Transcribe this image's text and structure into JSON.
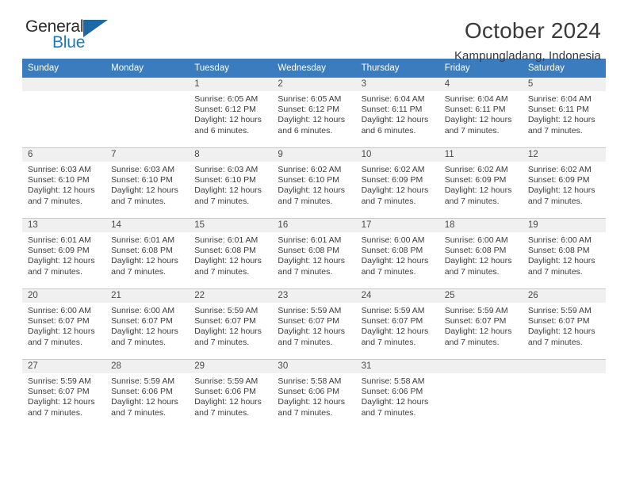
{
  "brand": {
    "name_part1": "General",
    "name_part2": "Blue",
    "triangle_color": "#1c69a8",
    "blue_color": "#1f79c0"
  },
  "header": {
    "title": "October 2024",
    "subtitle": "Kampungladang, Indonesia",
    "header_bg": "#3a7cbe",
    "daynum_bg": "#f0f0f0"
  },
  "weekdays": [
    "Sunday",
    "Monday",
    "Tuesday",
    "Wednesday",
    "Thursday",
    "Friday",
    "Saturday"
  ],
  "labels": {
    "sunrise_prefix": "Sunrise: ",
    "sunset_prefix": "Sunset: ",
    "daylight_prefix": "Daylight: "
  },
  "weeks": [
    [
      {
        "day": "",
        "empty": true
      },
      {
        "day": "",
        "empty": true
      },
      {
        "day": "1",
        "sunrise": "Sunrise: 6:05 AM",
        "sunset": "Sunset: 6:12 PM",
        "daylight1": "Daylight: 12 hours",
        "daylight2": "and 6 minutes."
      },
      {
        "day": "2",
        "sunrise": "Sunrise: 6:05 AM",
        "sunset": "Sunset: 6:12 PM",
        "daylight1": "Daylight: 12 hours",
        "daylight2": "and 6 minutes."
      },
      {
        "day": "3",
        "sunrise": "Sunrise: 6:04 AM",
        "sunset": "Sunset: 6:11 PM",
        "daylight1": "Daylight: 12 hours",
        "daylight2": "and 6 minutes."
      },
      {
        "day": "4",
        "sunrise": "Sunrise: 6:04 AM",
        "sunset": "Sunset: 6:11 PM",
        "daylight1": "Daylight: 12 hours",
        "daylight2": "and 7 minutes."
      },
      {
        "day": "5",
        "sunrise": "Sunrise: 6:04 AM",
        "sunset": "Sunset: 6:11 PM",
        "daylight1": "Daylight: 12 hours",
        "daylight2": "and 7 minutes."
      }
    ],
    [
      {
        "day": "6",
        "sunrise": "Sunrise: 6:03 AM",
        "sunset": "Sunset: 6:10 PM",
        "daylight1": "Daylight: 12 hours",
        "daylight2": "and 7 minutes."
      },
      {
        "day": "7",
        "sunrise": "Sunrise: 6:03 AM",
        "sunset": "Sunset: 6:10 PM",
        "daylight1": "Daylight: 12 hours",
        "daylight2": "and 7 minutes."
      },
      {
        "day": "8",
        "sunrise": "Sunrise: 6:03 AM",
        "sunset": "Sunset: 6:10 PM",
        "daylight1": "Daylight: 12 hours",
        "daylight2": "and 7 minutes."
      },
      {
        "day": "9",
        "sunrise": "Sunrise: 6:02 AM",
        "sunset": "Sunset: 6:10 PM",
        "daylight1": "Daylight: 12 hours",
        "daylight2": "and 7 minutes."
      },
      {
        "day": "10",
        "sunrise": "Sunrise: 6:02 AM",
        "sunset": "Sunset: 6:09 PM",
        "daylight1": "Daylight: 12 hours",
        "daylight2": "and 7 minutes."
      },
      {
        "day": "11",
        "sunrise": "Sunrise: 6:02 AM",
        "sunset": "Sunset: 6:09 PM",
        "daylight1": "Daylight: 12 hours",
        "daylight2": "and 7 minutes."
      },
      {
        "day": "12",
        "sunrise": "Sunrise: 6:02 AM",
        "sunset": "Sunset: 6:09 PM",
        "daylight1": "Daylight: 12 hours",
        "daylight2": "and 7 minutes."
      }
    ],
    [
      {
        "day": "13",
        "sunrise": "Sunrise: 6:01 AM",
        "sunset": "Sunset: 6:09 PM",
        "daylight1": "Daylight: 12 hours",
        "daylight2": "and 7 minutes."
      },
      {
        "day": "14",
        "sunrise": "Sunrise: 6:01 AM",
        "sunset": "Sunset: 6:08 PM",
        "daylight1": "Daylight: 12 hours",
        "daylight2": "and 7 minutes."
      },
      {
        "day": "15",
        "sunrise": "Sunrise: 6:01 AM",
        "sunset": "Sunset: 6:08 PM",
        "daylight1": "Daylight: 12 hours",
        "daylight2": "and 7 minutes."
      },
      {
        "day": "16",
        "sunrise": "Sunrise: 6:01 AM",
        "sunset": "Sunset: 6:08 PM",
        "daylight1": "Daylight: 12 hours",
        "daylight2": "and 7 minutes."
      },
      {
        "day": "17",
        "sunrise": "Sunrise: 6:00 AM",
        "sunset": "Sunset: 6:08 PM",
        "daylight1": "Daylight: 12 hours",
        "daylight2": "and 7 minutes."
      },
      {
        "day": "18",
        "sunrise": "Sunrise: 6:00 AM",
        "sunset": "Sunset: 6:08 PM",
        "daylight1": "Daylight: 12 hours",
        "daylight2": "and 7 minutes."
      },
      {
        "day": "19",
        "sunrise": "Sunrise: 6:00 AM",
        "sunset": "Sunset: 6:08 PM",
        "daylight1": "Daylight: 12 hours",
        "daylight2": "and 7 minutes."
      }
    ],
    [
      {
        "day": "20",
        "sunrise": "Sunrise: 6:00 AM",
        "sunset": "Sunset: 6:07 PM",
        "daylight1": "Daylight: 12 hours",
        "daylight2": "and 7 minutes."
      },
      {
        "day": "21",
        "sunrise": "Sunrise: 6:00 AM",
        "sunset": "Sunset: 6:07 PM",
        "daylight1": "Daylight: 12 hours",
        "daylight2": "and 7 minutes."
      },
      {
        "day": "22",
        "sunrise": "Sunrise: 5:59 AM",
        "sunset": "Sunset: 6:07 PM",
        "daylight1": "Daylight: 12 hours",
        "daylight2": "and 7 minutes."
      },
      {
        "day": "23",
        "sunrise": "Sunrise: 5:59 AM",
        "sunset": "Sunset: 6:07 PM",
        "daylight1": "Daylight: 12 hours",
        "daylight2": "and 7 minutes."
      },
      {
        "day": "24",
        "sunrise": "Sunrise: 5:59 AM",
        "sunset": "Sunset: 6:07 PM",
        "daylight1": "Daylight: 12 hours",
        "daylight2": "and 7 minutes."
      },
      {
        "day": "25",
        "sunrise": "Sunrise: 5:59 AM",
        "sunset": "Sunset: 6:07 PM",
        "daylight1": "Daylight: 12 hours",
        "daylight2": "and 7 minutes."
      },
      {
        "day": "26",
        "sunrise": "Sunrise: 5:59 AM",
        "sunset": "Sunset: 6:07 PM",
        "daylight1": "Daylight: 12 hours",
        "daylight2": "and 7 minutes."
      }
    ],
    [
      {
        "day": "27",
        "sunrise": "Sunrise: 5:59 AM",
        "sunset": "Sunset: 6:07 PM",
        "daylight1": "Daylight: 12 hours",
        "daylight2": "and 7 minutes."
      },
      {
        "day": "28",
        "sunrise": "Sunrise: 5:59 AM",
        "sunset": "Sunset: 6:06 PM",
        "daylight1": "Daylight: 12 hours",
        "daylight2": "and 7 minutes."
      },
      {
        "day": "29",
        "sunrise": "Sunrise: 5:59 AM",
        "sunset": "Sunset: 6:06 PM",
        "daylight1": "Daylight: 12 hours",
        "daylight2": "and 7 minutes."
      },
      {
        "day": "30",
        "sunrise": "Sunrise: 5:58 AM",
        "sunset": "Sunset: 6:06 PM",
        "daylight1": "Daylight: 12 hours",
        "daylight2": "and 7 minutes."
      },
      {
        "day": "31",
        "sunrise": "Sunrise: 5:58 AM",
        "sunset": "Sunset: 6:06 PM",
        "daylight1": "Daylight: 12 hours",
        "daylight2": "and 7 minutes."
      },
      {
        "day": "",
        "empty": true
      },
      {
        "day": "",
        "empty": true
      }
    ]
  ]
}
